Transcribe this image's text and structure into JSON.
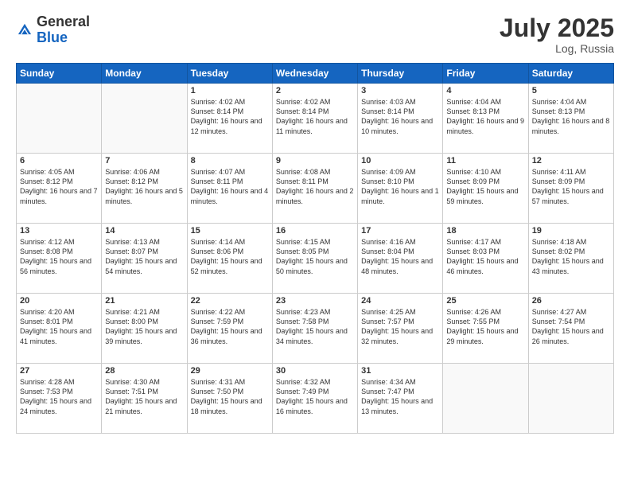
{
  "header": {
    "logo_general": "General",
    "logo_blue": "Blue",
    "month_year": "July 2025",
    "location": "Log, Russia"
  },
  "weekdays": [
    "Sunday",
    "Monday",
    "Tuesday",
    "Wednesday",
    "Thursday",
    "Friday",
    "Saturday"
  ],
  "weeks": [
    [
      {
        "day": "",
        "info": ""
      },
      {
        "day": "",
        "info": ""
      },
      {
        "day": "1",
        "info": "Sunrise: 4:02 AM\nSunset: 8:14 PM\nDaylight: 16 hours and 12 minutes."
      },
      {
        "day": "2",
        "info": "Sunrise: 4:02 AM\nSunset: 8:14 PM\nDaylight: 16 hours and 11 minutes."
      },
      {
        "day": "3",
        "info": "Sunrise: 4:03 AM\nSunset: 8:14 PM\nDaylight: 16 hours and 10 minutes."
      },
      {
        "day": "4",
        "info": "Sunrise: 4:04 AM\nSunset: 8:13 PM\nDaylight: 16 hours and 9 minutes."
      },
      {
        "day": "5",
        "info": "Sunrise: 4:04 AM\nSunset: 8:13 PM\nDaylight: 16 hours and 8 minutes."
      }
    ],
    [
      {
        "day": "6",
        "info": "Sunrise: 4:05 AM\nSunset: 8:12 PM\nDaylight: 16 hours and 7 minutes."
      },
      {
        "day": "7",
        "info": "Sunrise: 4:06 AM\nSunset: 8:12 PM\nDaylight: 16 hours and 5 minutes."
      },
      {
        "day": "8",
        "info": "Sunrise: 4:07 AM\nSunset: 8:11 PM\nDaylight: 16 hours and 4 minutes."
      },
      {
        "day": "9",
        "info": "Sunrise: 4:08 AM\nSunset: 8:11 PM\nDaylight: 16 hours and 2 minutes."
      },
      {
        "day": "10",
        "info": "Sunrise: 4:09 AM\nSunset: 8:10 PM\nDaylight: 16 hours and 1 minute."
      },
      {
        "day": "11",
        "info": "Sunrise: 4:10 AM\nSunset: 8:09 PM\nDaylight: 15 hours and 59 minutes."
      },
      {
        "day": "12",
        "info": "Sunrise: 4:11 AM\nSunset: 8:09 PM\nDaylight: 15 hours and 57 minutes."
      }
    ],
    [
      {
        "day": "13",
        "info": "Sunrise: 4:12 AM\nSunset: 8:08 PM\nDaylight: 15 hours and 56 minutes."
      },
      {
        "day": "14",
        "info": "Sunrise: 4:13 AM\nSunset: 8:07 PM\nDaylight: 15 hours and 54 minutes."
      },
      {
        "day": "15",
        "info": "Sunrise: 4:14 AM\nSunset: 8:06 PM\nDaylight: 15 hours and 52 minutes."
      },
      {
        "day": "16",
        "info": "Sunrise: 4:15 AM\nSunset: 8:05 PM\nDaylight: 15 hours and 50 minutes."
      },
      {
        "day": "17",
        "info": "Sunrise: 4:16 AM\nSunset: 8:04 PM\nDaylight: 15 hours and 48 minutes."
      },
      {
        "day": "18",
        "info": "Sunrise: 4:17 AM\nSunset: 8:03 PM\nDaylight: 15 hours and 46 minutes."
      },
      {
        "day": "19",
        "info": "Sunrise: 4:18 AM\nSunset: 8:02 PM\nDaylight: 15 hours and 43 minutes."
      }
    ],
    [
      {
        "day": "20",
        "info": "Sunrise: 4:20 AM\nSunset: 8:01 PM\nDaylight: 15 hours and 41 minutes."
      },
      {
        "day": "21",
        "info": "Sunrise: 4:21 AM\nSunset: 8:00 PM\nDaylight: 15 hours and 39 minutes."
      },
      {
        "day": "22",
        "info": "Sunrise: 4:22 AM\nSunset: 7:59 PM\nDaylight: 15 hours and 36 minutes."
      },
      {
        "day": "23",
        "info": "Sunrise: 4:23 AM\nSunset: 7:58 PM\nDaylight: 15 hours and 34 minutes."
      },
      {
        "day": "24",
        "info": "Sunrise: 4:25 AM\nSunset: 7:57 PM\nDaylight: 15 hours and 32 minutes."
      },
      {
        "day": "25",
        "info": "Sunrise: 4:26 AM\nSunset: 7:55 PM\nDaylight: 15 hours and 29 minutes."
      },
      {
        "day": "26",
        "info": "Sunrise: 4:27 AM\nSunset: 7:54 PM\nDaylight: 15 hours and 26 minutes."
      }
    ],
    [
      {
        "day": "27",
        "info": "Sunrise: 4:28 AM\nSunset: 7:53 PM\nDaylight: 15 hours and 24 minutes."
      },
      {
        "day": "28",
        "info": "Sunrise: 4:30 AM\nSunset: 7:51 PM\nDaylight: 15 hours and 21 minutes."
      },
      {
        "day": "29",
        "info": "Sunrise: 4:31 AM\nSunset: 7:50 PM\nDaylight: 15 hours and 18 minutes."
      },
      {
        "day": "30",
        "info": "Sunrise: 4:32 AM\nSunset: 7:49 PM\nDaylight: 15 hours and 16 minutes."
      },
      {
        "day": "31",
        "info": "Sunrise: 4:34 AM\nSunset: 7:47 PM\nDaylight: 15 hours and 13 minutes."
      },
      {
        "day": "",
        "info": ""
      },
      {
        "day": "",
        "info": ""
      }
    ]
  ]
}
